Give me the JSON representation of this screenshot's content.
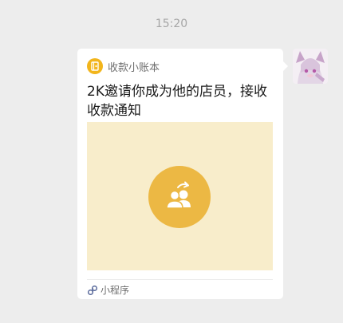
{
  "chat": {
    "timestamp": "15:20"
  },
  "message": {
    "app_name": "收款小账本",
    "title": "2K邀请你成为他的店员，接收收款通知",
    "footer_label": "小程序",
    "cover_icon": "invite-staff-icon",
    "accent_color": "#ecb844",
    "cover_color": "#f8edcb"
  }
}
